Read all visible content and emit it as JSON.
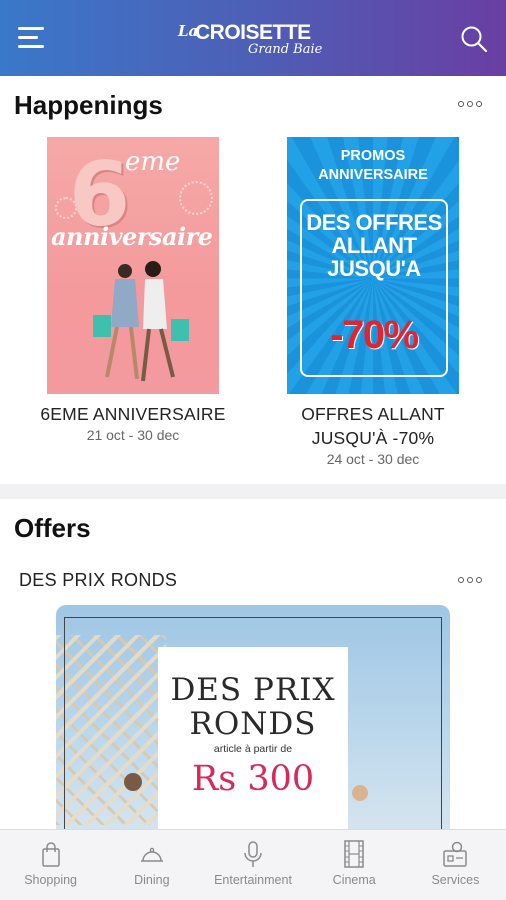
{
  "header": {
    "logo_prefix": "La",
    "logo_main": "CROISETTE",
    "logo_sub": "Grand Baie",
    "menu_icon": "hamburger-icon",
    "search_icon": "search-icon",
    "colors": {
      "gradient_start": "#3a78c9",
      "gradient_end": "#6a3ea3"
    }
  },
  "happenings": {
    "title": "Happenings",
    "cards": [
      {
        "title": "6EME ANNIVERSAIRE",
        "date": "21 oct - 30 dec",
        "poster": {
          "number": "6",
          "suffix": "eme",
          "word": "anniversaire"
        }
      },
      {
        "title": "OFFRES ALLANT JUSQU'À -70%",
        "date": "24 oct - 30 dec",
        "poster": {
          "heading": "PROMOS ANNIVERSAIRE",
          "body": "DES OFFRES ALLANT JUSQU'A",
          "discount": "-70%"
        }
      }
    ]
  },
  "offers": {
    "title": "Offers",
    "items": [
      {
        "name": "DES PRIX RONDS",
        "poster": {
          "headline": "DES PRIX RONDS",
          "subtitle": "article à partir de",
          "price": "Rs 300"
        }
      }
    ]
  },
  "bottom_nav": {
    "items": [
      {
        "label": "Shopping",
        "icon": "shopping-bag-icon"
      },
      {
        "label": "Dining",
        "icon": "cloche-icon"
      },
      {
        "label": "Entertainment",
        "icon": "microphone-icon"
      },
      {
        "label": "Cinema",
        "icon": "film-strip-icon"
      },
      {
        "label": "Services",
        "icon": "services-icon"
      }
    ]
  }
}
